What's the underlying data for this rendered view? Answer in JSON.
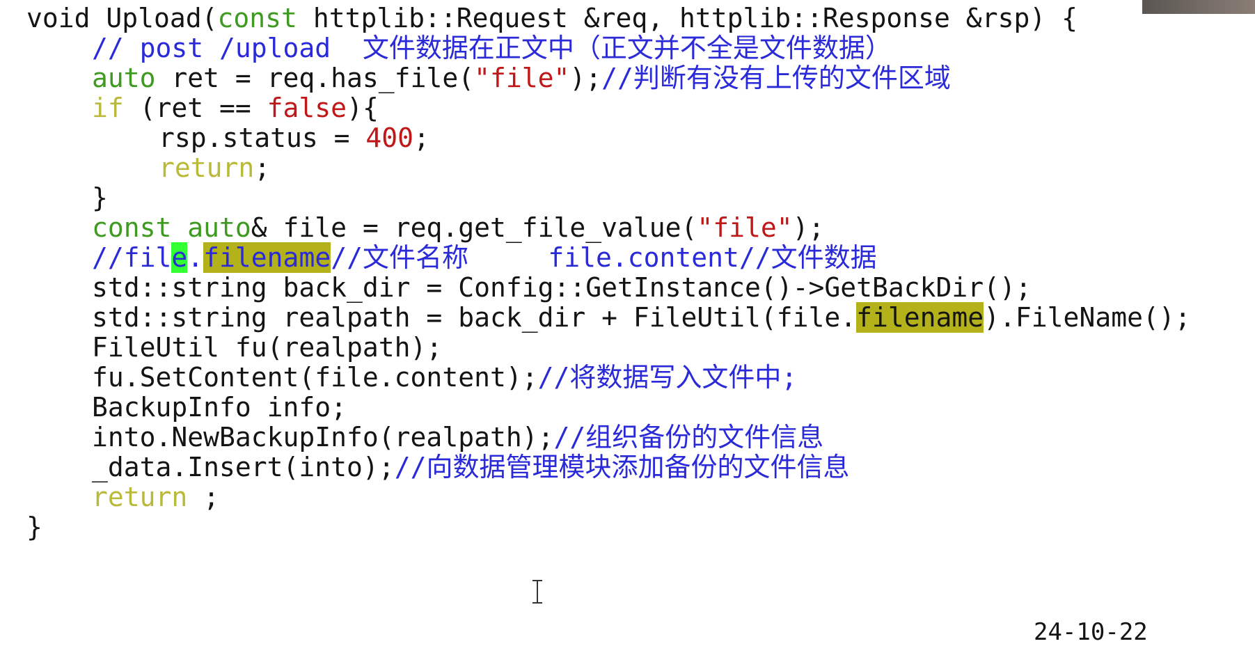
{
  "code": {
    "l1": {
      "a": "void Upload(",
      "kw": "const",
      "b": " httplib::Request &req, httplib::Response &rsp) {"
    },
    "l2": {
      "comment": "// post /upload  文件数据在正文中（正文并不全是文件数据）"
    },
    "l3": {
      "kw": "auto",
      "a": " ret = req.has_file(",
      "str": "\"file\"",
      "b": ");",
      "comment": "//判断有没有上传的文件区域"
    },
    "l4": {
      "kw": "if",
      "a": " (ret == ",
      "val": "false",
      "b": "){"
    },
    "l5": {
      "a": "rsp.status = ",
      "num": "400",
      "b": ";"
    },
    "l6": {
      "kw": "return",
      "b": ";"
    },
    "l7": {
      "a": "}"
    },
    "l8": {
      "kw1": "const",
      "kw2": "auto",
      "a": "& file = req.get_file_value(",
      "str": "\"file\"",
      "b": ");"
    },
    "l9": {
      "c1": "//fil",
      "cursor_char": "e",
      "c2": ".",
      "hl_word": "filename",
      "c3": "//文件名称     file.content//文件数据"
    },
    "l10": {
      "a": "std::string back_dir = Config::GetInstance()->GetBackDir();"
    },
    "l11": {
      "a": "std::string realpath = back_dir + FileUtil(file.",
      "hl_word": "filename",
      "b": ").FileName();"
    },
    "l12": {
      "a": "FileUtil fu(realpath);"
    },
    "l13": {
      "a": "fu.SetContent(file.content);",
      "comment": "//将数据写入文件中;"
    },
    "l14": {
      "a": "BackupInfo info;"
    },
    "l15": {
      "a": "into.NewBackupInfo(realpath);",
      "comment": "//组织备份的文件信息"
    },
    "l16": {
      "a": "_data.Insert(into);",
      "comment": "//向数据管理模块添加备份的文件信息"
    },
    "l17": {
      "kw": "return",
      "b": " ;"
    },
    "l18": {
      "a": "}"
    }
  },
  "timestamp": "24-10-22",
  "colors": {
    "keyword_green": "#3f9a22",
    "keyword_yellow": "#b9b93a",
    "string": "#c01818",
    "comment": "#2a2ad8",
    "highlight": "#b4b21b",
    "cursor_highlight": "#33ff33"
  },
  "icons": {
    "text_cursor": "i-beam-cursor-icon"
  }
}
